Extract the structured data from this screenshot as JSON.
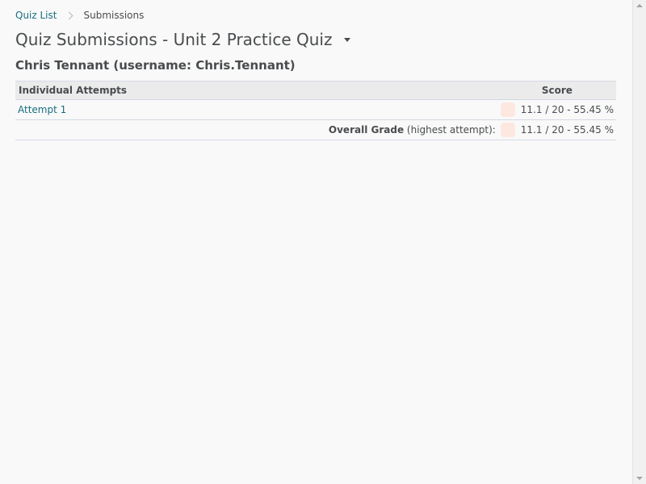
{
  "breadcrumb": {
    "parent": "Quiz List",
    "current": "Submissions"
  },
  "page": {
    "title": "Quiz Submissions - Unit 2 Practice Quiz",
    "title_menu_icon": "chevron-down-icon"
  },
  "user": {
    "heading": "Chris Tennant (username: Chris.Tennant)"
  },
  "table": {
    "headers": {
      "attempts": "Individual Attempts",
      "score": "Score"
    },
    "rows": [
      {
        "attempt": "Attempt 1",
        "score": "11.1 / 20 - 55.45 %",
        "swatch_color": "#fde8e0"
      }
    ],
    "overall": {
      "label": "Overall Grade",
      "sublabel": " (highest attempt):",
      "score": "11.1 / 20 - 55.45 %",
      "swatch_color": "#fde8e0"
    }
  },
  "colors": {
    "link": "#1a6f80",
    "text": "#494c4e",
    "header_bg": "#ebebeb"
  }
}
